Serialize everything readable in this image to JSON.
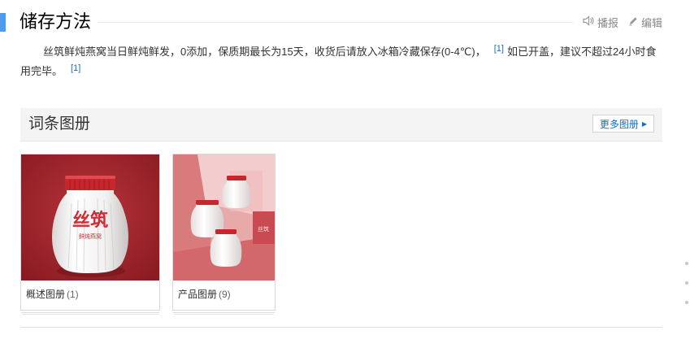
{
  "section": {
    "title": "储存方法",
    "actions": [
      {
        "label": "播报",
        "icon": "speaker-icon"
      },
      {
        "label": "编辑",
        "icon": "pencil-icon"
      }
    ]
  },
  "paragraph": {
    "text_1": "丝筑鲜炖燕窝当日鲜炖鲜发，0添加，保质期最长为15天，收货后请放入冰箱冷藏保存(0-4℃)，",
    "ref_1": "[1]",
    "text_2": "如已开盖，建议不超过24小时食用完毕。",
    "ref_2": "[1]"
  },
  "album": {
    "title": "词条图册",
    "more_label": "更多图册",
    "cards": [
      {
        "label": "概述图册",
        "count": "(1)",
        "lid_text": "丝筑",
        "jar_caption": "鲜炖燕窝"
      },
      {
        "label": "产品图册",
        "count": "(9)",
        "jar_caption": "丝筑"
      }
    ]
  },
  "colors": {
    "accent": "#4f9cee",
    "link": "#136ec2",
    "card1_bg": "#a8232a",
    "card2_bg": "#e4a1a1"
  }
}
